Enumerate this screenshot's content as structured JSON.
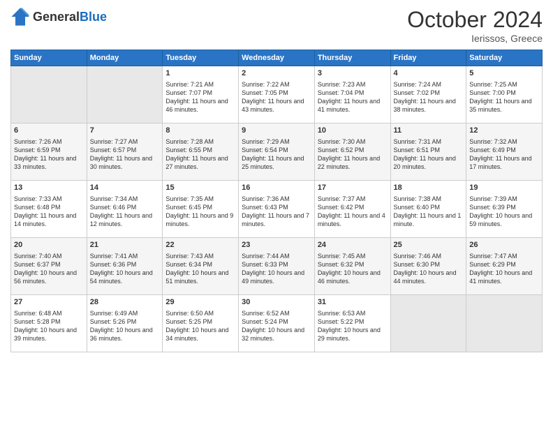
{
  "header": {
    "logo_general": "General",
    "logo_blue": "Blue",
    "month": "October 2024",
    "location": "Ierissos, Greece"
  },
  "days_of_week": [
    "Sunday",
    "Monday",
    "Tuesday",
    "Wednesday",
    "Thursday",
    "Friday",
    "Saturday"
  ],
  "weeks": [
    [
      {
        "day": "",
        "sunrise": "",
        "sunset": "",
        "daylight": ""
      },
      {
        "day": "",
        "sunrise": "",
        "sunset": "",
        "daylight": ""
      },
      {
        "day": "1",
        "sunrise": "Sunrise: 7:21 AM",
        "sunset": "Sunset: 7:07 PM",
        "daylight": "Daylight: 11 hours and 46 minutes."
      },
      {
        "day": "2",
        "sunrise": "Sunrise: 7:22 AM",
        "sunset": "Sunset: 7:05 PM",
        "daylight": "Daylight: 11 hours and 43 minutes."
      },
      {
        "day": "3",
        "sunrise": "Sunrise: 7:23 AM",
        "sunset": "Sunset: 7:04 PM",
        "daylight": "Daylight: 11 hours and 41 minutes."
      },
      {
        "day": "4",
        "sunrise": "Sunrise: 7:24 AM",
        "sunset": "Sunset: 7:02 PM",
        "daylight": "Daylight: 11 hours and 38 minutes."
      },
      {
        "day": "5",
        "sunrise": "Sunrise: 7:25 AM",
        "sunset": "Sunset: 7:00 PM",
        "daylight": "Daylight: 11 hours and 35 minutes."
      }
    ],
    [
      {
        "day": "6",
        "sunrise": "Sunrise: 7:26 AM",
        "sunset": "Sunset: 6:59 PM",
        "daylight": "Daylight: 11 hours and 33 minutes."
      },
      {
        "day": "7",
        "sunrise": "Sunrise: 7:27 AM",
        "sunset": "Sunset: 6:57 PM",
        "daylight": "Daylight: 11 hours and 30 minutes."
      },
      {
        "day": "8",
        "sunrise": "Sunrise: 7:28 AM",
        "sunset": "Sunset: 6:55 PM",
        "daylight": "Daylight: 11 hours and 27 minutes."
      },
      {
        "day": "9",
        "sunrise": "Sunrise: 7:29 AM",
        "sunset": "Sunset: 6:54 PM",
        "daylight": "Daylight: 11 hours and 25 minutes."
      },
      {
        "day": "10",
        "sunrise": "Sunrise: 7:30 AM",
        "sunset": "Sunset: 6:52 PM",
        "daylight": "Daylight: 11 hours and 22 minutes."
      },
      {
        "day": "11",
        "sunrise": "Sunrise: 7:31 AM",
        "sunset": "Sunset: 6:51 PM",
        "daylight": "Daylight: 11 hours and 20 minutes."
      },
      {
        "day": "12",
        "sunrise": "Sunrise: 7:32 AM",
        "sunset": "Sunset: 6:49 PM",
        "daylight": "Daylight: 11 hours and 17 minutes."
      }
    ],
    [
      {
        "day": "13",
        "sunrise": "Sunrise: 7:33 AM",
        "sunset": "Sunset: 6:48 PM",
        "daylight": "Daylight: 11 hours and 14 minutes."
      },
      {
        "day": "14",
        "sunrise": "Sunrise: 7:34 AM",
        "sunset": "Sunset: 6:46 PM",
        "daylight": "Daylight: 11 hours and 12 minutes."
      },
      {
        "day": "15",
        "sunrise": "Sunrise: 7:35 AM",
        "sunset": "Sunset: 6:45 PM",
        "daylight": "Daylight: 11 hours and 9 minutes."
      },
      {
        "day": "16",
        "sunrise": "Sunrise: 7:36 AM",
        "sunset": "Sunset: 6:43 PM",
        "daylight": "Daylight: 11 hours and 7 minutes."
      },
      {
        "day": "17",
        "sunrise": "Sunrise: 7:37 AM",
        "sunset": "Sunset: 6:42 PM",
        "daylight": "Daylight: 11 hours and 4 minutes."
      },
      {
        "day": "18",
        "sunrise": "Sunrise: 7:38 AM",
        "sunset": "Sunset: 6:40 PM",
        "daylight": "Daylight: 11 hours and 1 minute."
      },
      {
        "day": "19",
        "sunrise": "Sunrise: 7:39 AM",
        "sunset": "Sunset: 6:39 PM",
        "daylight": "Daylight: 10 hours and 59 minutes."
      }
    ],
    [
      {
        "day": "20",
        "sunrise": "Sunrise: 7:40 AM",
        "sunset": "Sunset: 6:37 PM",
        "daylight": "Daylight: 10 hours and 56 minutes."
      },
      {
        "day": "21",
        "sunrise": "Sunrise: 7:41 AM",
        "sunset": "Sunset: 6:36 PM",
        "daylight": "Daylight: 10 hours and 54 minutes."
      },
      {
        "day": "22",
        "sunrise": "Sunrise: 7:43 AM",
        "sunset": "Sunset: 6:34 PM",
        "daylight": "Daylight: 10 hours and 51 minutes."
      },
      {
        "day": "23",
        "sunrise": "Sunrise: 7:44 AM",
        "sunset": "Sunset: 6:33 PM",
        "daylight": "Daylight: 10 hours and 49 minutes."
      },
      {
        "day": "24",
        "sunrise": "Sunrise: 7:45 AM",
        "sunset": "Sunset: 6:32 PM",
        "daylight": "Daylight: 10 hours and 46 minutes."
      },
      {
        "day": "25",
        "sunrise": "Sunrise: 7:46 AM",
        "sunset": "Sunset: 6:30 PM",
        "daylight": "Daylight: 10 hours and 44 minutes."
      },
      {
        "day": "26",
        "sunrise": "Sunrise: 7:47 AM",
        "sunset": "Sunset: 6:29 PM",
        "daylight": "Daylight: 10 hours and 41 minutes."
      }
    ],
    [
      {
        "day": "27",
        "sunrise": "Sunrise: 6:48 AM",
        "sunset": "Sunset: 5:28 PM",
        "daylight": "Daylight: 10 hours and 39 minutes."
      },
      {
        "day": "28",
        "sunrise": "Sunrise: 6:49 AM",
        "sunset": "Sunset: 5:26 PM",
        "daylight": "Daylight: 10 hours and 36 minutes."
      },
      {
        "day": "29",
        "sunrise": "Sunrise: 6:50 AM",
        "sunset": "Sunset: 5:25 PM",
        "daylight": "Daylight: 10 hours and 34 minutes."
      },
      {
        "day": "30",
        "sunrise": "Sunrise: 6:52 AM",
        "sunset": "Sunset: 5:24 PM",
        "daylight": "Daylight: 10 hours and 32 minutes."
      },
      {
        "day": "31",
        "sunrise": "Sunrise: 6:53 AM",
        "sunset": "Sunset: 5:22 PM",
        "daylight": "Daylight: 10 hours and 29 minutes."
      },
      {
        "day": "",
        "sunrise": "",
        "sunset": "",
        "daylight": ""
      },
      {
        "day": "",
        "sunrise": "",
        "sunset": "",
        "daylight": ""
      }
    ]
  ]
}
